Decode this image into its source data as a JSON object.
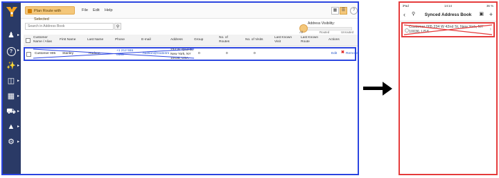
{
  "desktop": {
    "toolbar": {
      "plan_button_label": "Plan Route with Selected",
      "menu": [
        "File",
        "Edit",
        "Help"
      ],
      "help_symbol": "?"
    },
    "search": {
      "placeholder": "Search in Address Book",
      "button_icon": "search-icon"
    },
    "visibility": {
      "title": "Address Visibility:",
      "labels": [
        "All",
        "Routed",
        "Unrouted"
      ]
    },
    "table": {
      "headers": [
        "Customer Name / Alias",
        "First Name",
        "Last Name",
        "Phone",
        "E-mail",
        "Address",
        "Group",
        "No. of Routes",
        "No. of Visits",
        "Last Known Visit",
        "Last Known Route",
        "Actions"
      ],
      "row": {
        "customer": "Customer 005",
        "first_name": "Stanley",
        "last_name": "Hudson",
        "phone": "+1 212 555 0105",
        "email": "hudson@route4m",
        "address": "234 W 42nd St, New York, NY 10036, USA",
        "group": "0",
        "routes": "0",
        "visits": "0",
        "edit_label": "Edit",
        "remove_label": "Remove"
      }
    },
    "colors": {
      "sidebar": "#2a3a66",
      "accent": "#f4c77a",
      "frame": "#2a44e0"
    }
  },
  "phone": {
    "status": {
      "left": "iPad",
      "time": "14:14",
      "battery": "36 %"
    },
    "title": "Synced Address Book",
    "cell_text": "Customer 005 234 W 42nd St, New York, NY 10036, USA",
    "colors": {
      "frame": "#e53b3b"
    }
  }
}
